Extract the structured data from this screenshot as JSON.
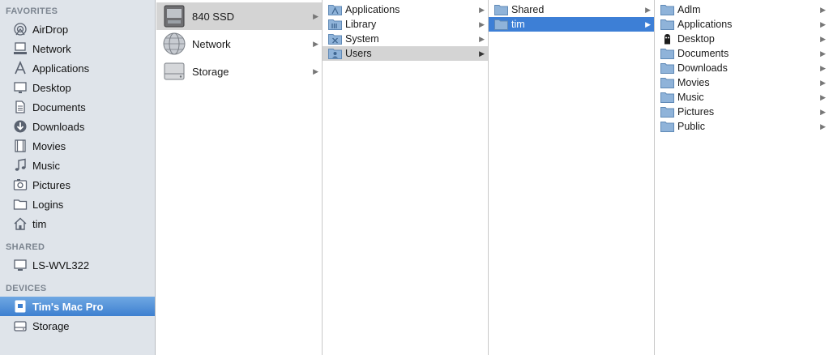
{
  "sidebar": {
    "sections": [
      {
        "title": "FAVORITES",
        "items": [
          {
            "label": "AirDrop",
            "icon": "airdrop-icon"
          },
          {
            "label": "Network",
            "icon": "network-icon"
          },
          {
            "label": "Applications",
            "icon": "applications-icon"
          },
          {
            "label": "Desktop",
            "icon": "desktop-icon"
          },
          {
            "label": "Documents",
            "icon": "documents-icon"
          },
          {
            "label": "Downloads",
            "icon": "downloads-icon"
          },
          {
            "label": "Movies",
            "icon": "movies-icon"
          },
          {
            "label": "Music",
            "icon": "music-icon"
          },
          {
            "label": "Pictures",
            "icon": "pictures-icon"
          },
          {
            "label": "Logins",
            "icon": "folder-icon"
          },
          {
            "label": "tim",
            "icon": "home-icon"
          }
        ]
      },
      {
        "title": "SHARED",
        "items": [
          {
            "label": "LS-WVL322",
            "icon": "monitor-icon"
          }
        ]
      },
      {
        "title": "DEVICES",
        "items": [
          {
            "label": "Tim's Mac Pro",
            "icon": "mac-pro-icon",
            "selected": true
          },
          {
            "label": "Storage",
            "icon": "disk-icon"
          }
        ]
      }
    ]
  },
  "columns": [
    {
      "items": [
        {
          "label": "840 SSD",
          "icon": "ssd-icon",
          "state": "gray"
        },
        {
          "label": "Network",
          "icon": "network-globe-icon"
        },
        {
          "label": "Storage",
          "icon": "hard-disk-icon"
        }
      ]
    },
    {
      "items": [
        {
          "label": "Applications",
          "icon": "applications-folder-icon"
        },
        {
          "label": "Library",
          "icon": "library-folder-icon"
        },
        {
          "label": "System",
          "icon": "system-folder-icon"
        },
        {
          "label": "Users",
          "icon": "users-folder-icon",
          "state": "gray"
        }
      ]
    },
    {
      "items": [
        {
          "label": "Shared",
          "icon": "folder-icon"
        },
        {
          "label": "tim",
          "icon": "folder-icon",
          "state": "blue"
        }
      ]
    },
    {
      "items": [
        {
          "label": "Adlm",
          "icon": "folder-icon"
        },
        {
          "label": "Applications",
          "icon": "folder-icon"
        },
        {
          "label": "Desktop",
          "icon": "desktop-alien-icon"
        },
        {
          "label": "Documents",
          "icon": "folder-icon"
        },
        {
          "label": "Downloads",
          "icon": "folder-icon"
        },
        {
          "label": "Movies",
          "icon": "folder-icon"
        },
        {
          "label": "Music",
          "icon": "folder-icon"
        },
        {
          "label": "Pictures",
          "icon": "folder-icon"
        },
        {
          "label": "Public",
          "icon": "folder-icon"
        }
      ]
    }
  ],
  "colors": {
    "sidebar_bg": "#dfe4ea",
    "selection_blue": "#3d7fd6",
    "selection_gray": "#d4d4d4",
    "folder_blue": "#8fb3d9"
  }
}
